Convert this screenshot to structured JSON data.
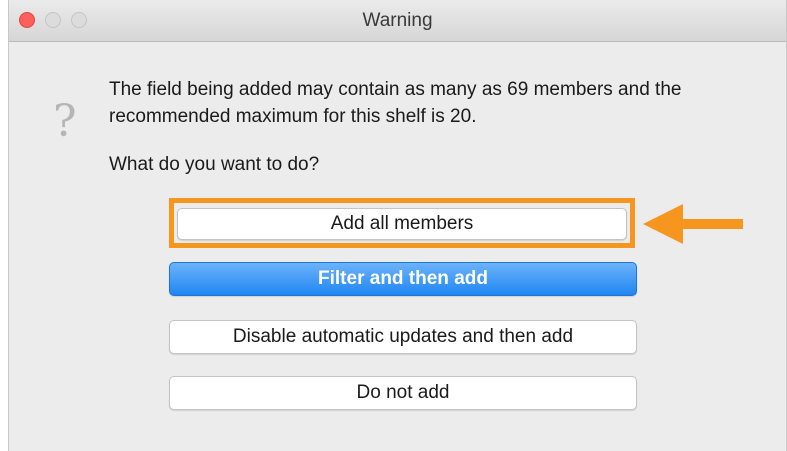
{
  "window": {
    "title": "Warning"
  },
  "dialog": {
    "icon": "question-mark-icon",
    "icon_glyph": "?",
    "message": "The field being added may contain as many as 69 members and the recommended maximum for this shelf is 20.",
    "prompt": "What do you want to do?"
  },
  "buttons": {
    "add_all": "Add all members",
    "filter": "Filter and then add",
    "disable": "Disable automatic updates and then add",
    "do_not_add": "Do not add"
  },
  "annotation": {
    "highlight_color": "#f7961e",
    "arrow_icon": "arrow-left-icon"
  },
  "colors": {
    "primary_button": "#1f86f2",
    "close_button": "#fc605b"
  }
}
